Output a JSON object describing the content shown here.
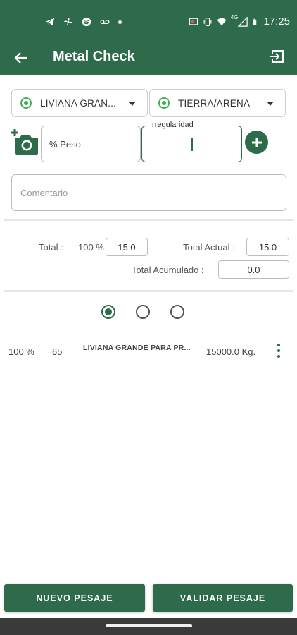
{
  "status_bar": {
    "time": "17:25",
    "network": "4G",
    "icons_left": [
      "telegram-icon",
      "fan-icon",
      "spotify-icon",
      "voicemail-icon",
      "dot-icon"
    ],
    "icons_right": [
      "cast-icon",
      "vibrate-icon",
      "wifi-icon",
      "signal-icon",
      "battery-icon"
    ]
  },
  "app_bar": {
    "title": "Metal Check",
    "back_icon": "arrow-left-icon",
    "exit_icon": "exit-icon"
  },
  "form": {
    "dropdown_left": {
      "value": "LIVIANA GRAN..."
    },
    "dropdown_right": {
      "value": "TIERRA/ARENA"
    },
    "peso_placeholder": "% Peso",
    "irregularidad_label": "Irregularidad",
    "comentario_placeholder": "Comentario"
  },
  "totals": {
    "total_label": "Total :",
    "total_percent": "100 %",
    "total_value": "15.0",
    "total_actual_label": "Total Actual :",
    "total_actual_value": "15.0",
    "total_acumulado_label": "Total Acumulado :",
    "total_acumulado_value": "0.0"
  },
  "radio_group": {
    "selected_index": 0,
    "count": 3
  },
  "list": [
    {
      "percent": "100 %",
      "code": "65",
      "name": "LIVIANA GRANDE PARA PR...",
      "weight": "15000.0 Kg."
    }
  ],
  "buttons": {
    "nuevo_pesaje": "NUEVO PESAJE",
    "validar_pesaje": "VALIDAR PESAJE"
  },
  "colors": {
    "primary": "#2e6b4a",
    "accent_green": "#3fae55"
  }
}
